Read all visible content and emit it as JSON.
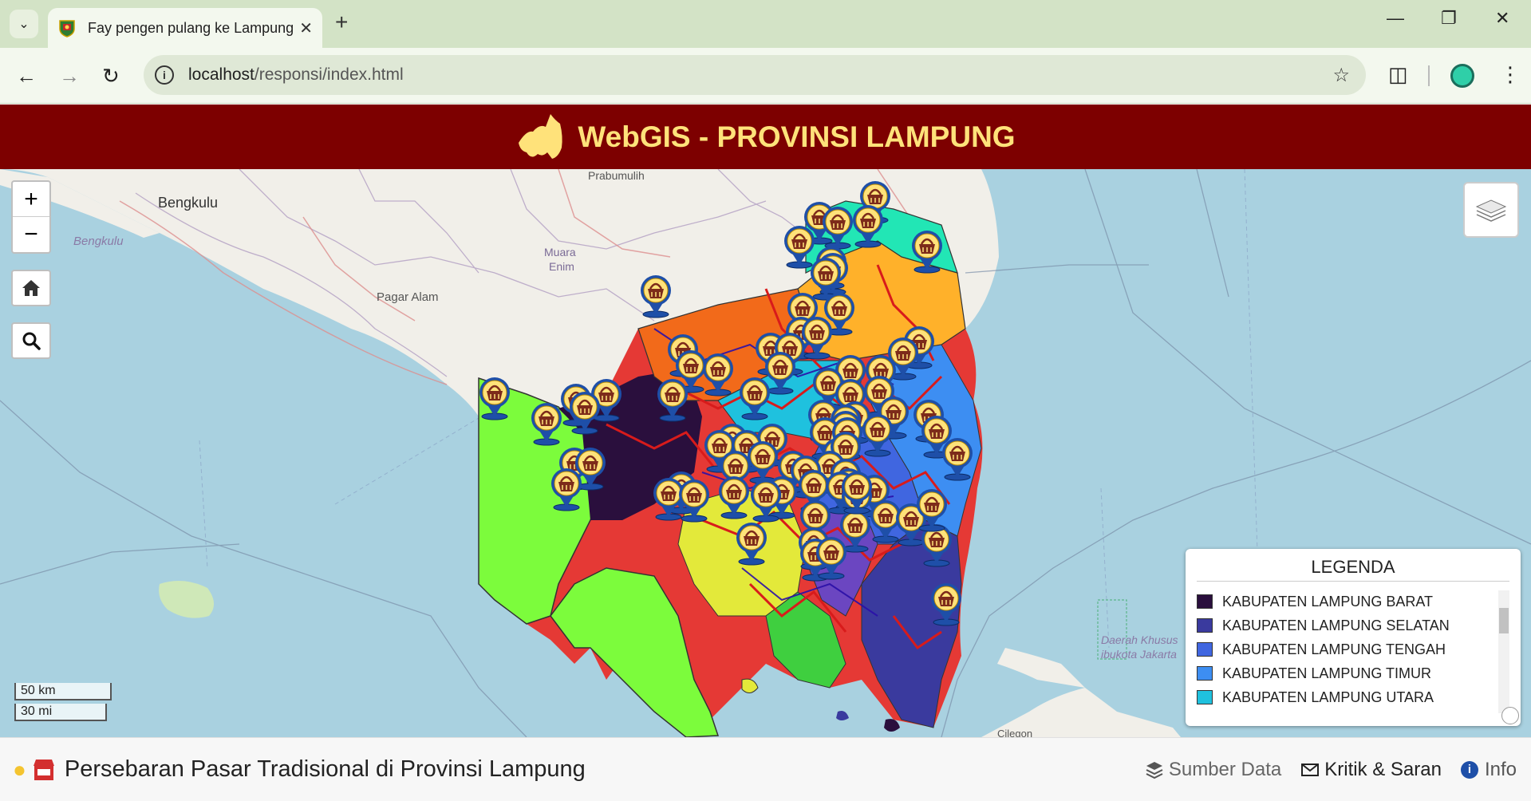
{
  "browser": {
    "tab_title": "Fay pengen pulang ke Lampung",
    "url_host": "localhost",
    "url_path": "/responsi/index.html"
  },
  "header": {
    "title": "WebGIS - PROVINSI LAMPUNG"
  },
  "map": {
    "labels": {
      "bengkulu_city": "Bengkulu",
      "bengkulu_region": "Bengkulu",
      "prabumulih": "Prabumulih",
      "muara_enim_1": "Muara",
      "muara_enim_2": "Enim",
      "pagar_alam": "Pagar Alam",
      "daerah_khusus_1": "Daerah Khusus",
      "daerah_khusus_2": "ibukota Jakarta",
      "cilegon": "Cilegon"
    },
    "scale": {
      "metric": "50 km",
      "imperial": "30 mi"
    },
    "zoom_in_label": "+",
    "zoom_out_label": "−"
  },
  "legend": {
    "title": "LEGENDA",
    "items": [
      {
        "label": "KABUPATEN LAMPUNG BARAT",
        "color": "#2a0f3d"
      },
      {
        "label": "KABUPATEN LAMPUNG SELATAN",
        "color": "#3a3a9e"
      },
      {
        "label": "KABUPATEN LAMPUNG TENGAH",
        "color": "#4066e0"
      },
      {
        "label": "KABUPATEN LAMPUNG TIMUR",
        "color": "#3d8ef2"
      },
      {
        "label": "KABUPATEN LAMPUNG UTARA",
        "color": "#1fc1de"
      }
    ]
  },
  "footer": {
    "title": "Persebaran Pasar Tradisional di Provinsi Lampung",
    "sumber_data": "Sumber Data",
    "kritik_saran": "Kritik & Saran",
    "info": "Info"
  },
  "colors": {
    "header_bg": "#7d0000",
    "header_text": "#ffe27a",
    "sea": "#a9d1e0"
  }
}
